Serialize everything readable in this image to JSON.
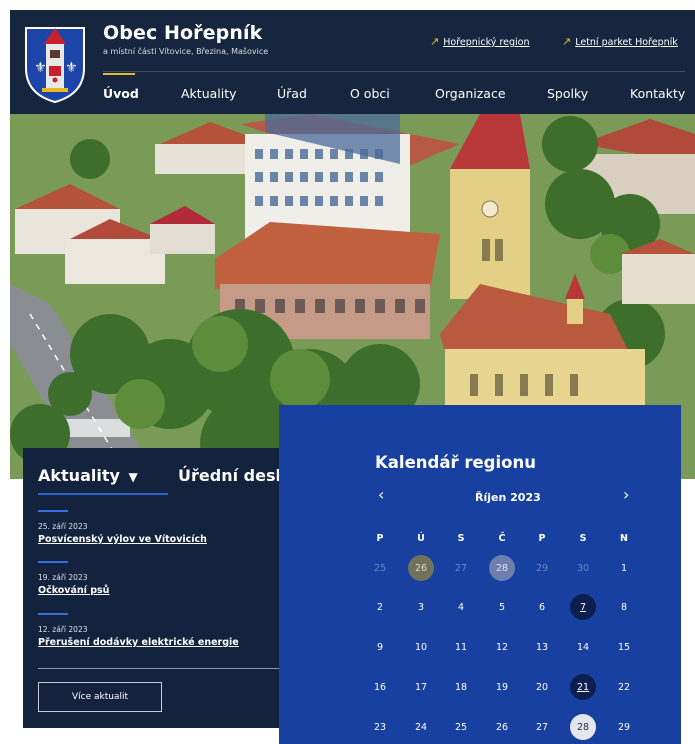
{
  "header": {
    "title": "Obec Hořepník",
    "subtitle": "a místní části Vítovice, Březina, Mašovice",
    "links": [
      {
        "label": "Hořepnický region"
      },
      {
        "label": "Letní parket Hořepník"
      }
    ],
    "nav": [
      {
        "label": "Úvod",
        "active": true
      },
      {
        "label": "Aktuality"
      },
      {
        "label": "Úřad"
      },
      {
        "label": "O obci"
      },
      {
        "label": "Organizace"
      },
      {
        "label": "Spolky"
      },
      {
        "label": "Kontakty"
      }
    ],
    "colors": {
      "navy": "#17263f",
      "accent": "#e7b928"
    }
  },
  "news": {
    "tab_active": "Aktuality",
    "tab_active_arrow": "▼",
    "tab_other": "Úřední deska",
    "tab_other_arrow": "▶",
    "items": [
      {
        "date": "25. září 2023",
        "headline": "Posvícenský výlov ve Vítovicích"
      },
      {
        "date": "19. září 2023",
        "headline": "Očkování psů"
      },
      {
        "date": "12. září 2023",
        "headline": "Přerušení dodávky elektrické energie"
      }
    ],
    "more_label": "Více aktualit"
  },
  "calendar": {
    "title": "Kalendář regionu",
    "month": "Říjen 2023",
    "prev": "‹",
    "next": "›",
    "weekdays": [
      "P",
      "Ú",
      "S",
      "Č",
      "P",
      "S",
      "N"
    ],
    "weeks": [
      [
        {
          "d": "25",
          "s": "muted"
        },
        {
          "d": "26",
          "s": "hl-olive"
        },
        {
          "d": "27",
          "s": "muted"
        },
        {
          "d": "28",
          "s": "hl-gray"
        },
        {
          "d": "29",
          "s": "muted"
        },
        {
          "d": "30",
          "s": "muted"
        },
        {
          "d": "1",
          "s": ""
        }
      ],
      [
        {
          "d": "2",
          "s": ""
        },
        {
          "d": "3",
          "s": ""
        },
        {
          "d": "4",
          "s": ""
        },
        {
          "d": "5",
          "s": ""
        },
        {
          "d": "6",
          "s": ""
        },
        {
          "d": "7",
          "s": "hl-dark"
        },
        {
          "d": "8",
          "s": ""
        }
      ],
      [
        {
          "d": "9",
          "s": ""
        },
        {
          "d": "10",
          "s": ""
        },
        {
          "d": "11",
          "s": ""
        },
        {
          "d": "12",
          "s": ""
        },
        {
          "d": "13",
          "s": ""
        },
        {
          "d": "14",
          "s": ""
        },
        {
          "d": "15",
          "s": ""
        }
      ],
      [
        {
          "d": "16",
          "s": ""
        },
        {
          "d": "17",
          "s": ""
        },
        {
          "d": "18",
          "s": ""
        },
        {
          "d": "19",
          "s": ""
        },
        {
          "d": "20",
          "s": ""
        },
        {
          "d": "21",
          "s": "hl-dark"
        },
        {
          "d": "22",
          "s": ""
        }
      ],
      [
        {
          "d": "23",
          "s": ""
        },
        {
          "d": "24",
          "s": ""
        },
        {
          "d": "25",
          "s": ""
        },
        {
          "d": "26",
          "s": ""
        },
        {
          "d": "27",
          "s": ""
        },
        {
          "d": "28",
          "s": "hl-light"
        },
        {
          "d": "29",
          "s": ""
        }
      ]
    ],
    "colors": {
      "background": "#1740a0"
    }
  }
}
